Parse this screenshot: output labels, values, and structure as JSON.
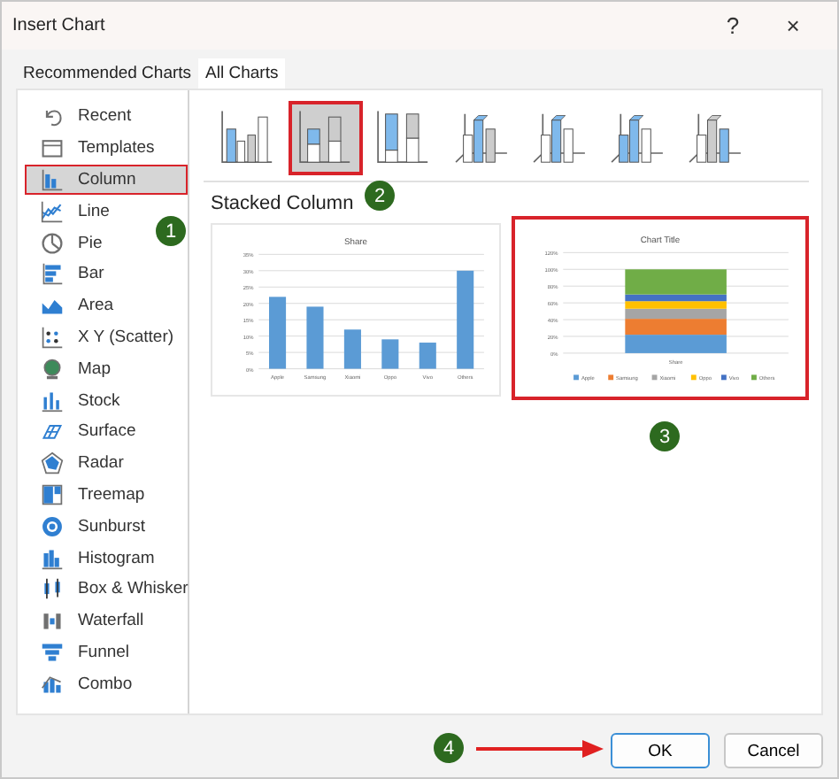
{
  "window": {
    "title": "Insert Chart",
    "help": "?",
    "close": "×"
  },
  "tabs": [
    {
      "label": "Recommended Charts",
      "selected": false
    },
    {
      "label": "All Charts",
      "selected": true
    }
  ],
  "sidebar": {
    "items": [
      {
        "label": "Recent",
        "selected": false,
        "highlighted": false
      },
      {
        "label": "Templates",
        "selected": false,
        "highlighted": false
      },
      {
        "label": "Column",
        "selected": true,
        "highlighted": true
      },
      {
        "label": "Line",
        "selected": false,
        "highlighted": false
      },
      {
        "label": "Pie",
        "selected": false,
        "highlighted": false
      },
      {
        "label": "Bar",
        "selected": false,
        "highlighted": false
      },
      {
        "label": "Area",
        "selected": false,
        "highlighted": false
      },
      {
        "label": "X Y (Scatter)",
        "selected": false,
        "highlighted": false
      },
      {
        "label": "Map",
        "selected": false,
        "highlighted": false
      },
      {
        "label": "Stock",
        "selected": false,
        "highlighted": false
      },
      {
        "label": "Surface",
        "selected": false,
        "highlighted": false
      },
      {
        "label": "Radar",
        "selected": false,
        "highlighted": false
      },
      {
        "label": "Treemap",
        "selected": false,
        "highlighted": false
      },
      {
        "label": "Sunburst",
        "selected": false,
        "highlighted": false
      },
      {
        "label": "Histogram",
        "selected": false,
        "highlighted": false
      },
      {
        "label": "Box & Whisker",
        "selected": false,
        "highlighted": false
      },
      {
        "label": "Waterfall",
        "selected": false,
        "highlighted": false
      },
      {
        "label": "Funnel",
        "selected": false,
        "highlighted": false
      },
      {
        "label": "Combo",
        "selected": false,
        "highlighted": false
      }
    ]
  },
  "subtypes": [
    {
      "selected": false,
      "highlighted": false
    },
    {
      "selected": true,
      "highlighted": true
    },
    {
      "selected": false,
      "highlighted": false
    },
    {
      "selected": false,
      "highlighted": false
    },
    {
      "selected": false,
      "highlighted": false
    },
    {
      "selected": false,
      "highlighted": false
    },
    {
      "selected": false,
      "highlighted": false
    }
  ],
  "subtype_title": "Stacked Column",
  "previews": [
    {
      "highlighted": false,
      "chart_data": {
        "type": "bar",
        "title": "Share",
        "grid": true,
        "categories": [
          "Apple",
          "Samsung",
          "Xiaomi",
          "Oppo",
          "Vivo",
          "Others"
        ],
        "series": [
          {
            "color": "#5b9bd5",
            "values": [
              22,
              19,
              12,
              9,
              8,
              30
            ]
          }
        ],
        "ylim": [
          0,
          35
        ],
        "yticks": [
          {
            "value": 0,
            "label": "0%"
          },
          {
            "value": 5,
            "label": "5%"
          },
          {
            "value": 10,
            "label": "10%"
          },
          {
            "value": 15,
            "label": "15%"
          },
          {
            "value": 20,
            "label": "20%"
          },
          {
            "value": 25,
            "label": "25%"
          },
          {
            "value": 30,
            "label": "30%"
          },
          {
            "value": 35,
            "label": "35%"
          }
        ]
      }
    },
    {
      "highlighted": true,
      "chart_data": {
        "type": "bar",
        "title": "Chart Title",
        "stacked": true,
        "grid": true,
        "legend": "bottom",
        "categories": [
          "Share"
        ],
        "series": [
          {
            "name": "Apple",
            "color": "#5b9bd5",
            "values": [
              22
            ]
          },
          {
            "name": "Samsung",
            "color": "#ed7d31",
            "values": [
              19
            ]
          },
          {
            "name": "Xiaomi",
            "color": "#a5a5a5",
            "values": [
              12
            ]
          },
          {
            "name": "Oppo",
            "color": "#ffc000",
            "values": [
              9
            ]
          },
          {
            "name": "Vivo",
            "color": "#4472c4",
            "values": [
              8
            ]
          },
          {
            "name": "Others",
            "color": "#70ad47",
            "values": [
              30
            ]
          }
        ],
        "ylim": [
          0,
          120
        ],
        "yticks": [
          {
            "value": 0,
            "label": "0%"
          },
          {
            "value": 20,
            "label": "20%"
          },
          {
            "value": 40,
            "label": "40%"
          },
          {
            "value": 60,
            "label": "60%"
          },
          {
            "value": 80,
            "label": "80%"
          },
          {
            "value": 100,
            "label": "100%"
          },
          {
            "value": 120,
            "label": "120%"
          }
        ]
      }
    }
  ],
  "buttons": [
    {
      "label": "OK",
      "default": true
    },
    {
      "label": "Cancel",
      "default": false
    }
  ],
  "callouts": [
    {
      "label": "1"
    },
    {
      "label": "2"
    },
    {
      "label": "3"
    },
    {
      "label": "4"
    }
  ]
}
